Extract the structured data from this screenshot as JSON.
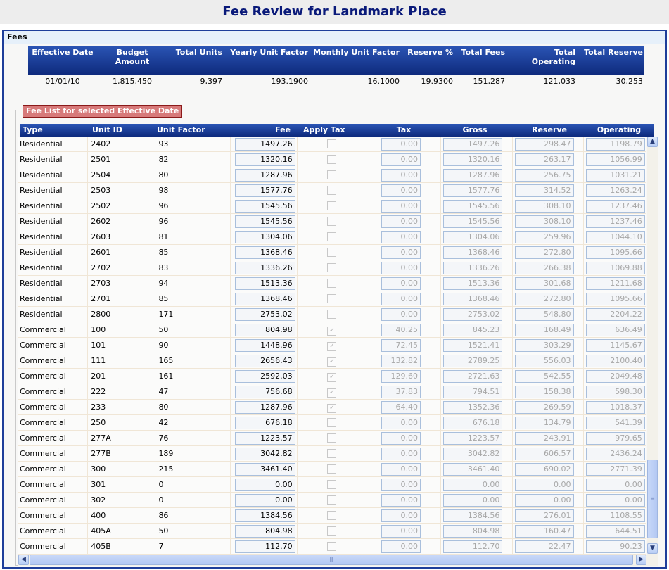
{
  "page": {
    "title": "Fee Review for Landmark Place"
  },
  "fees_panel": {
    "label": "Fees",
    "summary_headers": {
      "effective_date": "Effective Date",
      "budget_amount": "Budget Amount",
      "total_units": "Total Units",
      "yearly_unit_factor": "Yearly Unit Factor",
      "monthly_unit_factor": "Monthly Unit Factor",
      "reserve_pct": "Reserve %",
      "total_fees": "Total Fees",
      "total_operating": "Total Operating",
      "total_reserve": "Total Reserve"
    },
    "summary_row": {
      "effective_date": "01/01/10",
      "budget_amount": "1,815,450",
      "total_units": "9,397",
      "yearly_unit_factor": "193.1900",
      "monthly_unit_factor": "16.1000",
      "reserve_pct": "19.9300",
      "total_fees": "151,287",
      "total_operating": "121,033",
      "total_reserve": "30,253"
    }
  },
  "fee_list": {
    "legend": "Fee List for selected Effective Date",
    "columns": {
      "type": "Type",
      "unit_id": "Unit ID",
      "unit_factor": "Unit Factor",
      "fee": "Fee",
      "apply_tax": "Apply Tax",
      "tax": "Tax",
      "gross": "Gross",
      "reserve": "Reserve",
      "operating": "Operating"
    },
    "rows": [
      {
        "type": "Residential",
        "unit_id": "2402",
        "unit_factor": "93",
        "fee": "1497.26",
        "apply_tax": false,
        "tax": "0.00",
        "gross": "1497.26",
        "reserve": "298.47",
        "operating": "1198.79"
      },
      {
        "type": "Residential",
        "unit_id": "2501",
        "unit_factor": "82",
        "fee": "1320.16",
        "apply_tax": false,
        "tax": "0.00",
        "gross": "1320.16",
        "reserve": "263.17",
        "operating": "1056.99"
      },
      {
        "type": "Residential",
        "unit_id": "2504",
        "unit_factor": "80",
        "fee": "1287.96",
        "apply_tax": false,
        "tax": "0.00",
        "gross": "1287.96",
        "reserve": "256.75",
        "operating": "1031.21"
      },
      {
        "type": "Residential",
        "unit_id": "2503",
        "unit_factor": "98",
        "fee": "1577.76",
        "apply_tax": false,
        "tax": "0.00",
        "gross": "1577.76",
        "reserve": "314.52",
        "operating": "1263.24"
      },
      {
        "type": "Residential",
        "unit_id": "2502",
        "unit_factor": "96",
        "fee": "1545.56",
        "apply_tax": false,
        "tax": "0.00",
        "gross": "1545.56",
        "reserve": "308.10",
        "operating": "1237.46"
      },
      {
        "type": "Residential",
        "unit_id": "2602",
        "unit_factor": "96",
        "fee": "1545.56",
        "apply_tax": false,
        "tax": "0.00",
        "gross": "1545.56",
        "reserve": "308.10",
        "operating": "1237.46"
      },
      {
        "type": "Residential",
        "unit_id": "2603",
        "unit_factor": "81",
        "fee": "1304.06",
        "apply_tax": false,
        "tax": "0.00",
        "gross": "1304.06",
        "reserve": "259.96",
        "operating": "1044.10"
      },
      {
        "type": "Residential",
        "unit_id": "2601",
        "unit_factor": "85",
        "fee": "1368.46",
        "apply_tax": false,
        "tax": "0.00",
        "gross": "1368.46",
        "reserve": "272.80",
        "operating": "1095.66"
      },
      {
        "type": "Residential",
        "unit_id": "2702",
        "unit_factor": "83",
        "fee": "1336.26",
        "apply_tax": false,
        "tax": "0.00",
        "gross": "1336.26",
        "reserve": "266.38",
        "operating": "1069.88"
      },
      {
        "type": "Residential",
        "unit_id": "2703",
        "unit_factor": "94",
        "fee": "1513.36",
        "apply_tax": false,
        "tax": "0.00",
        "gross": "1513.36",
        "reserve": "301.68",
        "operating": "1211.68"
      },
      {
        "type": "Residential",
        "unit_id": "2701",
        "unit_factor": "85",
        "fee": "1368.46",
        "apply_tax": false,
        "tax": "0.00",
        "gross": "1368.46",
        "reserve": "272.80",
        "operating": "1095.66"
      },
      {
        "type": "Residential",
        "unit_id": "2800",
        "unit_factor": "171",
        "fee": "2753.02",
        "apply_tax": false,
        "tax": "0.00",
        "gross": "2753.02",
        "reserve": "548.80",
        "operating": "2204.22"
      },
      {
        "type": "Commercial",
        "unit_id": "100",
        "unit_factor": "50",
        "fee": "804.98",
        "apply_tax": true,
        "tax": "40.25",
        "gross": "845.23",
        "reserve": "168.49",
        "operating": "636.49"
      },
      {
        "type": "Commercial",
        "unit_id": "101",
        "unit_factor": "90",
        "fee": "1448.96",
        "apply_tax": true,
        "tax": "72.45",
        "gross": "1521.41",
        "reserve": "303.29",
        "operating": "1145.67"
      },
      {
        "type": "Commercial",
        "unit_id": "111",
        "unit_factor": "165",
        "fee": "2656.43",
        "apply_tax": true,
        "tax": "132.82",
        "gross": "2789.25",
        "reserve": "556.03",
        "operating": "2100.40"
      },
      {
        "type": "Commercial",
        "unit_id": "201",
        "unit_factor": "161",
        "fee": "2592.03",
        "apply_tax": true,
        "tax": "129.60",
        "gross": "2721.63",
        "reserve": "542.55",
        "operating": "2049.48"
      },
      {
        "type": "Commercial",
        "unit_id": "222",
        "unit_factor": "47",
        "fee": "756.68",
        "apply_tax": true,
        "tax": "37.83",
        "gross": "794.51",
        "reserve": "158.38",
        "operating": "598.30"
      },
      {
        "type": "Commercial",
        "unit_id": "233",
        "unit_factor": "80",
        "fee": "1287.96",
        "apply_tax": true,
        "tax": "64.40",
        "gross": "1352.36",
        "reserve": "269.59",
        "operating": "1018.37"
      },
      {
        "type": "Commercial",
        "unit_id": "250",
        "unit_factor": "42",
        "fee": "676.18",
        "apply_tax": false,
        "tax": "0.00",
        "gross": "676.18",
        "reserve": "134.79",
        "operating": "541.39"
      },
      {
        "type": "Commercial",
        "unit_id": "277A",
        "unit_factor": "76",
        "fee": "1223.57",
        "apply_tax": false,
        "tax": "0.00",
        "gross": "1223.57",
        "reserve": "243.91",
        "operating": "979.65"
      },
      {
        "type": "Commercial",
        "unit_id": "277B",
        "unit_factor": "189",
        "fee": "3042.82",
        "apply_tax": false,
        "tax": "0.00",
        "gross": "3042.82",
        "reserve": "606.57",
        "operating": "2436.24"
      },
      {
        "type": "Commercial",
        "unit_id": "300",
        "unit_factor": "215",
        "fee": "3461.40",
        "apply_tax": false,
        "tax": "0.00",
        "gross": "3461.40",
        "reserve": "690.02",
        "operating": "2771.39"
      },
      {
        "type": "Commercial",
        "unit_id": "301",
        "unit_factor": "0",
        "fee": "0.00",
        "apply_tax": false,
        "tax": "0.00",
        "gross": "0.00",
        "reserve": "0.00",
        "operating": "0.00"
      },
      {
        "type": "Commercial",
        "unit_id": "302",
        "unit_factor": "0",
        "fee": "0.00",
        "apply_tax": false,
        "tax": "0.00",
        "gross": "0.00",
        "reserve": "0.00",
        "operating": "0.00"
      },
      {
        "type": "Commercial",
        "unit_id": "400",
        "unit_factor": "86",
        "fee": "1384.56",
        "apply_tax": false,
        "tax": "0.00",
        "gross": "1384.56",
        "reserve": "276.01",
        "operating": "1108.55"
      },
      {
        "type": "Commercial",
        "unit_id": "405A",
        "unit_factor": "50",
        "fee": "804.98",
        "apply_tax": false,
        "tax": "0.00",
        "gross": "804.98",
        "reserve": "160.47",
        "operating": "644.51"
      },
      {
        "type": "Commercial",
        "unit_id": "405B",
        "unit_factor": "7",
        "fee": "112.70",
        "apply_tax": false,
        "tax": "0.00",
        "gross": "112.70",
        "reserve": "22.47",
        "operating": "90.23"
      }
    ]
  },
  "icons": {
    "scroll_up": "▲",
    "scroll_down": "▼",
    "scroll_left": "◀",
    "scroll_right": "▶",
    "grip": "≡",
    "grip_h": "Ⅲ",
    "check": "✓"
  }
}
